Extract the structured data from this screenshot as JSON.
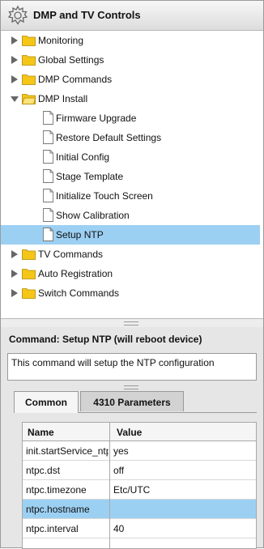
{
  "app": {
    "title": "DMP and TV Controls"
  },
  "tree": {
    "items": [
      {
        "label": "Monitoring",
        "type": "folder",
        "level": 0,
        "expanded": false
      },
      {
        "label": "Global Settings",
        "type": "folder",
        "level": 0,
        "expanded": false
      },
      {
        "label": "DMP Commands",
        "type": "folder",
        "level": 0,
        "expanded": false
      },
      {
        "label": "DMP Install",
        "type": "folder",
        "level": 0,
        "expanded": true
      },
      {
        "label": "Firmware Upgrade",
        "type": "doc",
        "level": 1
      },
      {
        "label": "Restore Default Settings",
        "type": "doc",
        "level": 1
      },
      {
        "label": "Initial Config",
        "type": "doc",
        "level": 1
      },
      {
        "label": "Stage Template",
        "type": "doc",
        "level": 1
      },
      {
        "label": "Initialize Touch Screen",
        "type": "doc",
        "level": 1
      },
      {
        "label": "Show Calibration",
        "type": "doc",
        "level": 1
      },
      {
        "label": "Setup NTP",
        "type": "doc",
        "level": 1,
        "selected": true
      },
      {
        "label": "TV Commands",
        "type": "folder",
        "level": 0,
        "expanded": false
      },
      {
        "label": "Auto Registration",
        "type": "folder",
        "level": 0,
        "expanded": false
      },
      {
        "label": "Switch Commands",
        "type": "folder",
        "level": 0,
        "expanded": false
      }
    ]
  },
  "command": {
    "title": "Command: Setup NTP (will reboot device)",
    "description": "This command will setup the NTP configuration"
  },
  "tabs": [
    {
      "label": "Common",
      "active": true
    },
    {
      "label": "4310 Parameters",
      "active": false
    }
  ],
  "grid": {
    "headers": [
      "Name",
      "Value"
    ],
    "rows": [
      {
        "name": "init.startService_ntp",
        "value": "yes"
      },
      {
        "name": "ntpc.dst",
        "value": "off"
      },
      {
        "name": "ntpc.timezone",
        "value": "Etc/UTC"
      },
      {
        "name": "ntpc.hostname",
        "value": "",
        "selected": true
      },
      {
        "name": "ntpc.interval",
        "value": "40"
      }
    ]
  },
  "colors": {
    "selection": "#9cd0f3",
    "folder": "#f5c518",
    "header_bg": "#dcdcdc"
  },
  "icons": {
    "app": "gear-icon",
    "folder": "folder-icon",
    "document": "document-icon",
    "expand": "triangle-right-icon",
    "collapse": "triangle-down-icon"
  }
}
